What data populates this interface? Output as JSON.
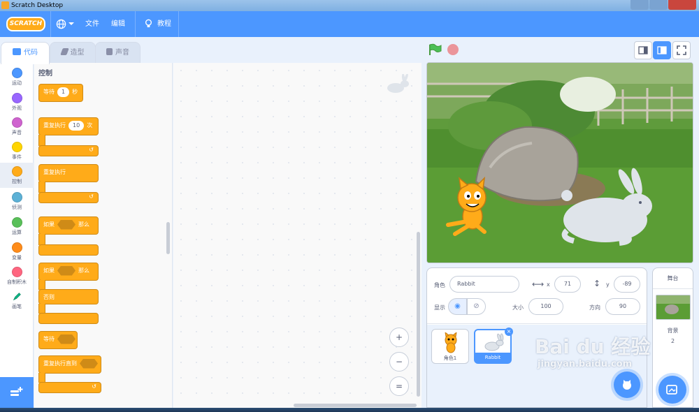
{
  "window": {
    "title": "Scratch Desktop"
  },
  "menubar": {
    "logo": "SCRATCH",
    "file": "文件",
    "edit": "编辑",
    "tutorials": "教程"
  },
  "tabs": {
    "code": "代码",
    "costumes": "造型",
    "sounds": "声音"
  },
  "categories": [
    {
      "label": "运动",
      "color": "#4c97ff"
    },
    {
      "label": "外观",
      "color": "#9966ff"
    },
    {
      "label": "声音",
      "color": "#cf63cf"
    },
    {
      "label": "事件",
      "color": "#ffd500"
    },
    {
      "label": "控制",
      "color": "#ffab19"
    },
    {
      "label": "侦测",
      "color": "#5cb1d6"
    },
    {
      "label": "运算",
      "color": "#59c059"
    },
    {
      "label": "变量",
      "color": "#ff8c1a"
    },
    {
      "label": "自制积木",
      "color": "#ff6680"
    },
    {
      "label": "画笔",
      "color": "#0fbd8c"
    }
  ],
  "palette": {
    "title": "控制",
    "wait": {
      "label": "等待",
      "value": "1",
      "unit": "秒"
    },
    "repeat": {
      "label": "重复执行",
      "value": "10",
      "unit": "次"
    },
    "forever": {
      "label": "重复执行"
    },
    "if_then": {
      "if": "如果",
      "then": "那么"
    },
    "if_else": {
      "if": "如果",
      "then": "那么",
      "else": "否则"
    },
    "wait_until": {
      "label": "等待"
    },
    "repeat_until": {
      "label": "重复执行直到"
    }
  },
  "zoom": {
    "in": "+",
    "out": "−",
    "reset": "="
  },
  "sprite_info": {
    "sprite_label": "角色",
    "sprite_name": "Rabbit",
    "x_label": "x",
    "x": "71",
    "y_label": "y",
    "y": "-89",
    "show_label": "显示",
    "size_label": "大小",
    "size": "100",
    "direction_label": "方向",
    "direction": "90"
  },
  "sprites": [
    {
      "name": "角色1",
      "selected": false
    },
    {
      "name": "Rabbit",
      "selected": true
    }
  ],
  "stage_pane": {
    "title": "舞台",
    "backdrop_label": "背景",
    "backdrop_count": "2"
  },
  "watermark": {
    "brand": "Bai du 经验",
    "url": "jingyan.baidu.com"
  },
  "colors": {
    "menu_blue": "#4c97ff",
    "control_orange": "#ffab19",
    "stop_red": "#ec5959",
    "flag_green": "#4cbf56"
  }
}
